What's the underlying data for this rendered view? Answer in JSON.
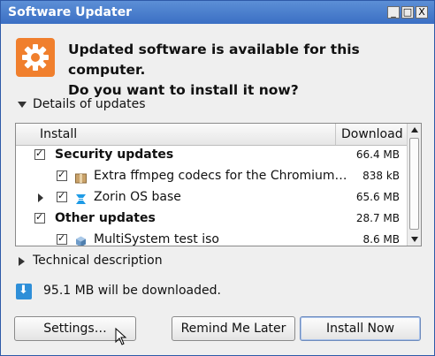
{
  "window": {
    "title": "Software Updater",
    "controls": {
      "minimize": "_",
      "maximize": "□",
      "close": "X"
    }
  },
  "header": {
    "line1": "Updated software is available for this computer.",
    "line2": "Do you want to install it now?"
  },
  "details_toggle": "Details of updates",
  "columns": {
    "install": "Install",
    "download": "Download"
  },
  "updates": [
    {
      "label": "Security updates",
      "size": "66.4 MB",
      "bold": true,
      "checked": true
    },
    {
      "label": "Extra ffmpeg codecs for the Chromium…",
      "size": "838 kB",
      "bold": false,
      "checked": true,
      "icon": "package-icon"
    },
    {
      "label": "Zorin OS base",
      "size": "65.6 MB",
      "bold": false,
      "checked": true,
      "icon": "zorin-icon",
      "expandable": true
    },
    {
      "label": "Other updates",
      "size": "28.7 MB",
      "bold": true,
      "checked": true
    },
    {
      "label": "MultiSystem test iso",
      "size": "8.6 MB",
      "bold": false,
      "checked": true,
      "icon": "cube-icon"
    }
  ],
  "technical_toggle": "Technical description",
  "download_summary": "95.1 MB will be downloaded.",
  "buttons": {
    "settings": "Settings…",
    "remind": "Remind Me Later",
    "install": "Install Now"
  },
  "colors": {
    "titlebar": "#3b6fc4",
    "app_icon": "#f07f2d",
    "download_icon": "#2f8fd8"
  }
}
